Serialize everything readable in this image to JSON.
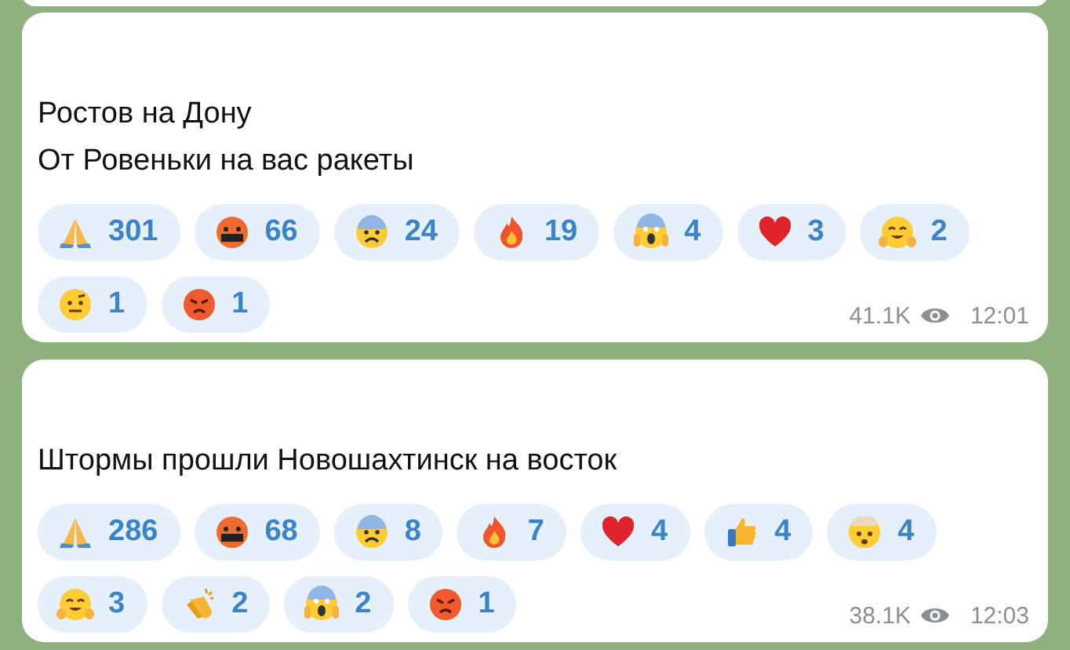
{
  "messages": [
    {
      "lines": [
        "Ростов на Дону",
        "От Ровеньки на вас ракеты"
      ],
      "reactions": [
        {
          "kind": "pray",
          "count": "301"
        },
        {
          "kind": "cursing",
          "count": "66"
        },
        {
          "kind": "fearful",
          "count": "24"
        },
        {
          "kind": "fire",
          "count": "19"
        },
        {
          "kind": "scream",
          "count": "4"
        },
        {
          "kind": "heart",
          "count": "3"
        },
        {
          "kind": "hug",
          "count": "2"
        },
        {
          "kind": "eyebrow",
          "count": "1"
        },
        {
          "kind": "angry",
          "count": "1"
        }
      ],
      "views": "41.1K",
      "time": "12:01"
    },
    {
      "lines": [
        "Штормы прошли Новошахтинск на восток"
      ],
      "reactions": [
        {
          "kind": "pray",
          "count": "286"
        },
        {
          "kind": "cursing",
          "count": "68"
        },
        {
          "kind": "fearful",
          "count": "8"
        },
        {
          "kind": "fire",
          "count": "7"
        },
        {
          "kind": "heart",
          "count": "4"
        },
        {
          "kind": "thumbsup",
          "count": "4"
        },
        {
          "kind": "exploding",
          "count": "4"
        },
        {
          "kind": "hug",
          "count": "3"
        },
        {
          "kind": "clap",
          "count": "2"
        },
        {
          "kind": "scream",
          "count": "2"
        },
        {
          "kind": "angry",
          "count": "1"
        }
      ],
      "views": "38.1K",
      "time": "12:03"
    }
  ]
}
